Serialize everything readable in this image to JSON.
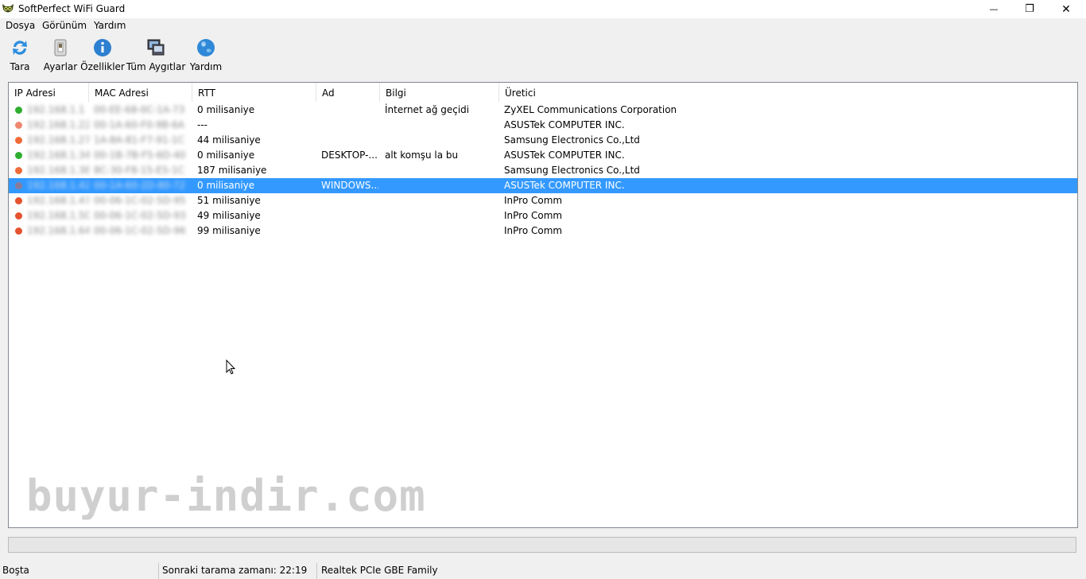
{
  "window": {
    "title": "SoftPerfect WiFi Guard",
    "minimize_symbol": "—",
    "maximize_symbol": "❐",
    "close_symbol": "✕"
  },
  "menu": [
    "Dosya",
    "Görünüm",
    "Yardım"
  ],
  "toolbar": {
    "scan_label": "Tara",
    "settings_label": "Ayarlar",
    "properties_label": "Özellikler",
    "all_devices_label": "Tüm Aygıtlar",
    "help_label": "Yardım"
  },
  "table": {
    "columns": [
      "IP Adresi",
      "MAC Adresi",
      "RTT",
      "Ad",
      "Bilgi",
      "Üretici"
    ],
    "rows": [
      {
        "status": "green",
        "ip": "192.168.1.1",
        "mac": "00-EE-68-0C-1A-73",
        "rtt": "0 milisaniye",
        "name": "",
        "info": "İnternet ağ geçidi",
        "vendor": "ZyXEL Communications Corporation"
      },
      {
        "status": "salmon",
        "ip": "192.168.1.22",
        "mac": "00-1A-60-F0-9B-6A",
        "rtt": "---",
        "name": "",
        "info": "",
        "vendor": "ASUSTek COMPUTER INC."
      },
      {
        "status": "orange",
        "ip": "192.168.1.27",
        "mac": "1A-8A-81-F7-91-1C",
        "rtt": "44 milisaniye",
        "name": "",
        "info": "",
        "vendor": "Samsung Electronics Co.,Ltd"
      },
      {
        "status": "green",
        "ip": "192.168.1.34",
        "mac": "00-1B-7B-F5-6D-40",
        "rtt": "0 milisaniye",
        "name": "DESKTOP-...",
        "info": "alt komşu la bu",
        "vendor": "ASUSTek COMPUTER INC."
      },
      {
        "status": "orange",
        "ip": "192.168.1.38",
        "mac": "8C-30-F8-15-E5-1C",
        "rtt": "187 milisaniye",
        "name": "",
        "info": "",
        "vendor": "Samsung Electronics Co.,Ltd"
      },
      {
        "status": "purple",
        "ip": "192.168.1.42",
        "mac": "00-1A-60-2D-80-72",
        "rtt": "0 milisaniye",
        "name": "WINDOWS...",
        "info": "",
        "vendor": "ASUSTek COMPUTER INC.",
        "selected": true
      },
      {
        "status": "red",
        "ip": "192.168.1.47",
        "mac": "00-06-1C-02-5D-95",
        "rtt": "51 milisaniye",
        "name": "",
        "info": "",
        "vendor": "InPro Comm"
      },
      {
        "status": "red",
        "ip": "192.168.1.50",
        "mac": "00-06-1C-02-5D-93",
        "rtt": "49 milisaniye",
        "name": "",
        "info": "",
        "vendor": "InPro Comm"
      },
      {
        "status": "red",
        "ip": "192.168.1.64",
        "mac": "00-06-1C-02-5D-96",
        "rtt": "99 milisaniye",
        "name": "",
        "info": "",
        "vendor": "InPro Comm"
      }
    ]
  },
  "status_colors": {
    "green": "#2fae2f",
    "salmon": "#f08870",
    "orange": "#ee6b38",
    "purple": "#8b7b98",
    "red": "#e5532e"
  },
  "watermark": "buyur-indir.com",
  "statusbar": {
    "state": "Boşta",
    "next_scan": "Sonraki tarama zamanı: 22:19",
    "adapter": "Realtek PCIe GBE Family"
  }
}
